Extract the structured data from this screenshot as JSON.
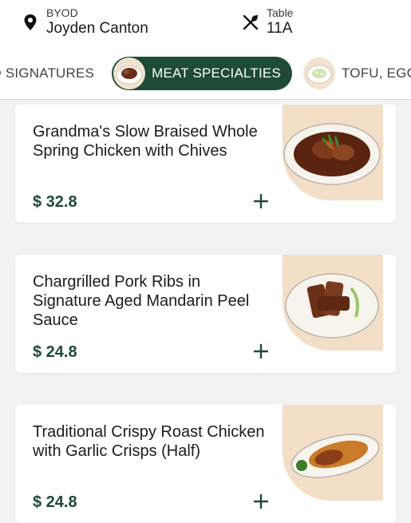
{
  "header": {
    "location_label": "BYOD",
    "location_name": "Joyden Canton",
    "table_label": "Table",
    "table_number": "11A"
  },
  "tabs": [
    {
      "label": "OD SIGNATURES",
      "active": false
    },
    {
      "label": "MEAT SPECIALTIES",
      "active": true
    },
    {
      "label": "TOFU, EGG AND",
      "active": false
    }
  ],
  "menu_items": [
    {
      "name": "Grandma's Slow Braised Whole Spring Chicken with Chives",
      "price": "$ 32.8"
    },
    {
      "name": "Chargrilled Pork Ribs in Signature Aged Mandarin Peel Sauce",
      "price": "$ 24.8"
    },
    {
      "name": "Traditional Crispy Roast Chicken with Garlic Crisps (Half)",
      "price": "$ 24.8"
    }
  ],
  "colors": {
    "accent": "#1f4a35",
    "image_bg": "#f3dfc7",
    "page_bg": "#f2f2f2"
  },
  "icons": {
    "location": "location-pin-icon",
    "table": "cutlery-icon",
    "add": "plus-icon"
  }
}
